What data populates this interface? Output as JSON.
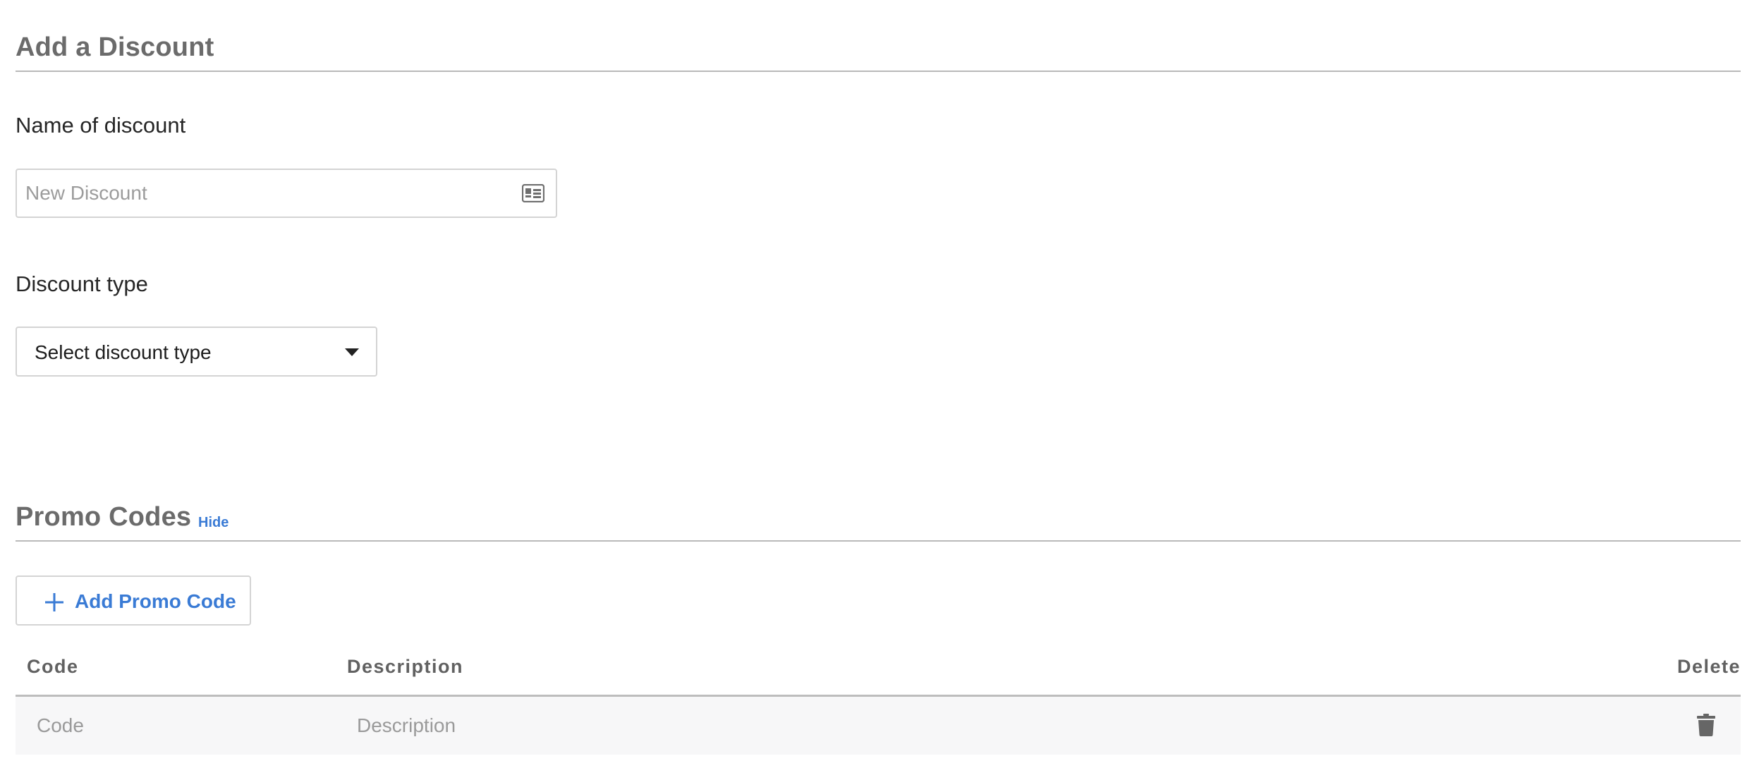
{
  "discount": {
    "title": "Add a Discount",
    "name_label": "Name of discount",
    "name_placeholder": "New Discount",
    "name_value": "",
    "type_label": "Discount type",
    "type_selected": "Select discount type"
  },
  "promo": {
    "title": "Promo Codes",
    "hide_label": "Hide",
    "add_button_label": "Add Promo Code",
    "columns": {
      "code": "Code",
      "description": "Description",
      "delete": "Delete"
    },
    "rows": [
      {
        "code_placeholder": "Code",
        "code_value": "",
        "description_placeholder": "Description",
        "description_value": ""
      }
    ]
  },
  "colors": {
    "link_blue": "#3a7bd5",
    "heading_gray": "#6b6b6b",
    "row_background": "#f7f7f8"
  },
  "icons": {
    "name_field": "id-card-icon",
    "select_caret": "caret-down-icon",
    "add_button": "plus-icon",
    "row_delete": "trash-icon"
  }
}
